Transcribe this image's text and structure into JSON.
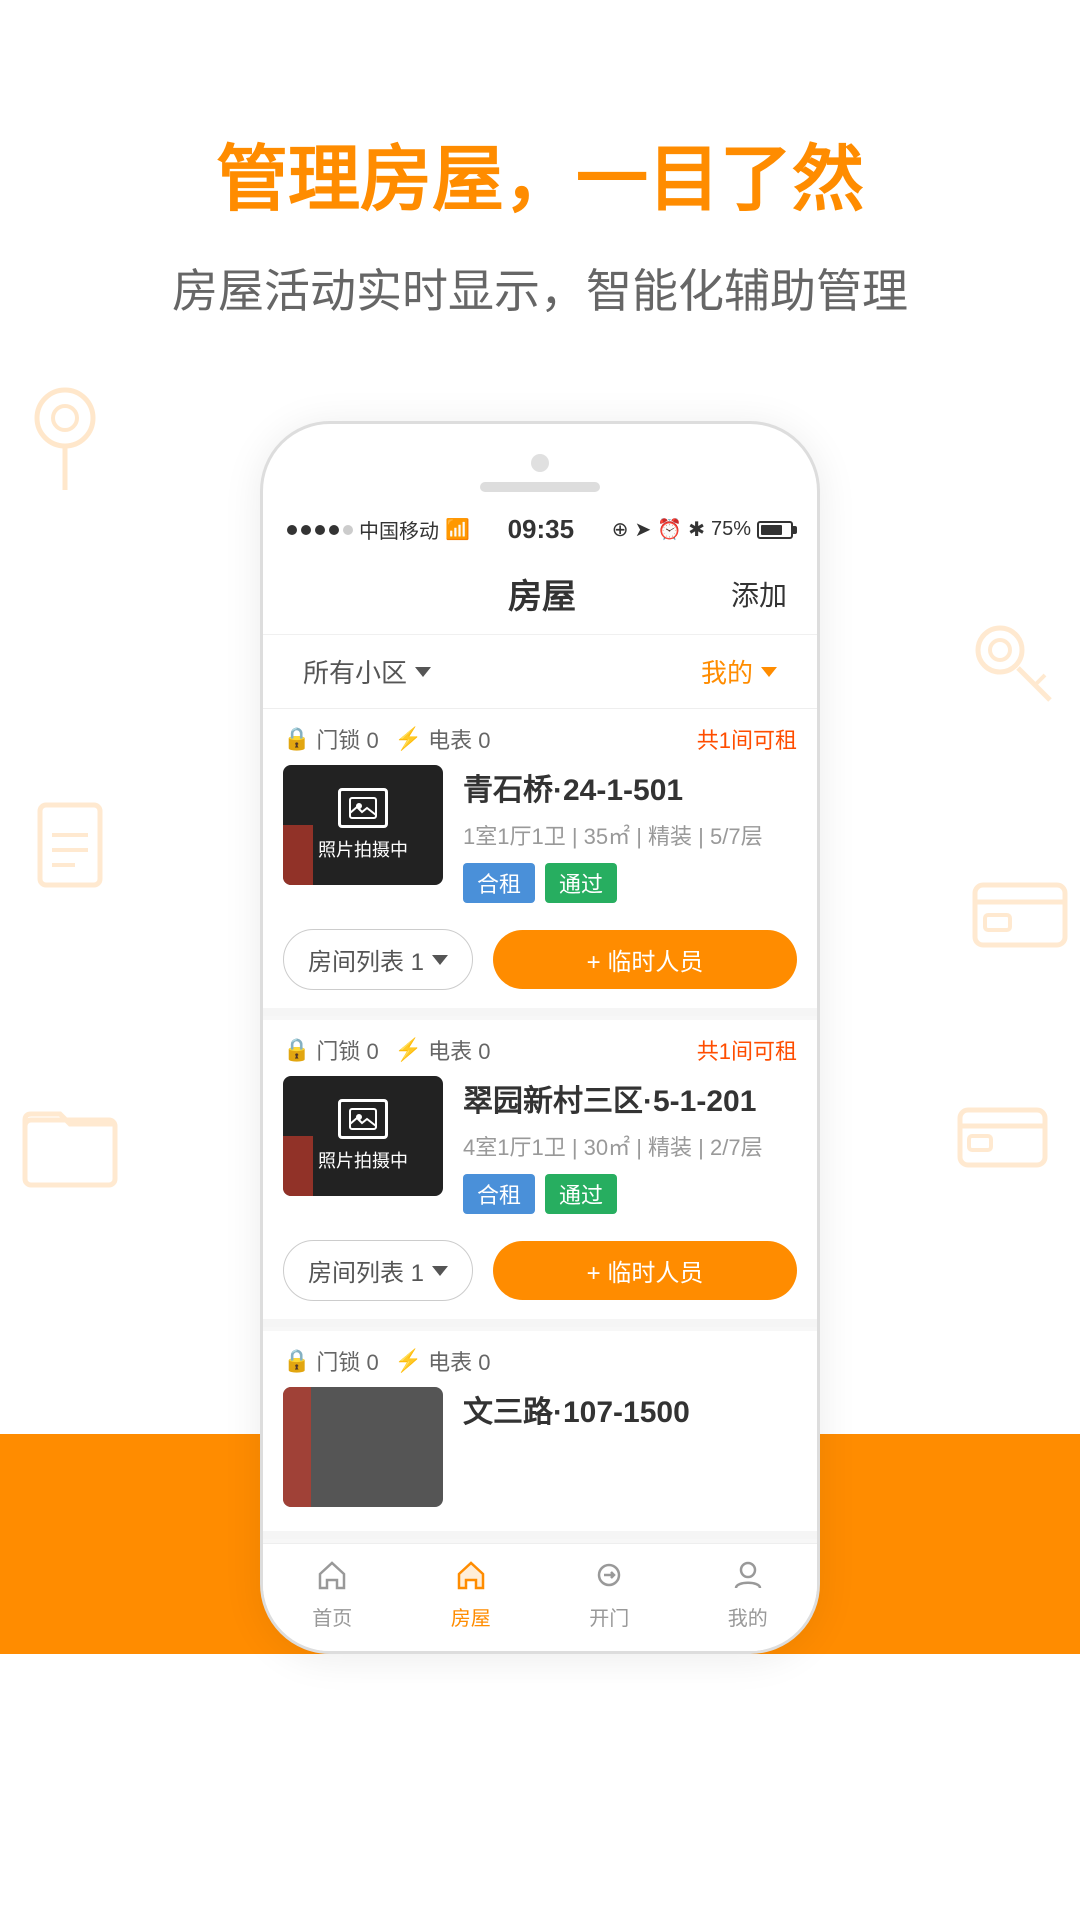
{
  "hero": {
    "title": "管理房屋，一目了然",
    "subtitle": "房屋活动实时显示，智能化辅助管理"
  },
  "status_bar": {
    "carrier": "中国移动",
    "time": "09:35",
    "battery": "75%"
  },
  "app_header": {
    "title": "房屋",
    "add_label": "添加"
  },
  "filter": {
    "left_label": "所有小区",
    "right_label": "我的"
  },
  "properties": [
    {
      "lock": "门锁 0",
      "electric": "电表 0",
      "available": "共",
      "available_num": "1",
      "available_suffix": "间可租",
      "name": "青石桥·24-1-501",
      "detail": "1室1厅1卫 | 35㎡ | 精装 | 5/7层",
      "tag1": "合租",
      "tag2": "通过",
      "room_list": "房间列表 1",
      "temp_staff": "+ 临时人员"
    },
    {
      "lock": "门锁 0",
      "electric": "电表 0",
      "available": "共",
      "available_num": "1",
      "available_suffix": "间可租",
      "name": "翠园新村三区·5-1-201",
      "detail": "4室1厅1卫 | 30㎡ | 精装 | 2/7层",
      "tag1": "合租",
      "tag2": "通过",
      "room_list": "房间列表 1",
      "temp_staff": "+ 临时人员"
    },
    {
      "lock": "门锁 0",
      "electric": "电表 0",
      "available": "",
      "available_num": "",
      "available_suffix": "",
      "name": "文三路·107-1500",
      "detail": "",
      "tag1": "",
      "tag2": "",
      "room_list": "",
      "temp_staff": ""
    }
  ],
  "bottom_nav": {
    "items": [
      {
        "label": "首页",
        "icon": "🏠",
        "active": false
      },
      {
        "label": "房屋",
        "icon": "🏠",
        "active": true
      },
      {
        "label": "开门",
        "icon": "🔑",
        "active": false
      },
      {
        "label": "我的",
        "icon": "👤",
        "active": false
      }
    ]
  }
}
